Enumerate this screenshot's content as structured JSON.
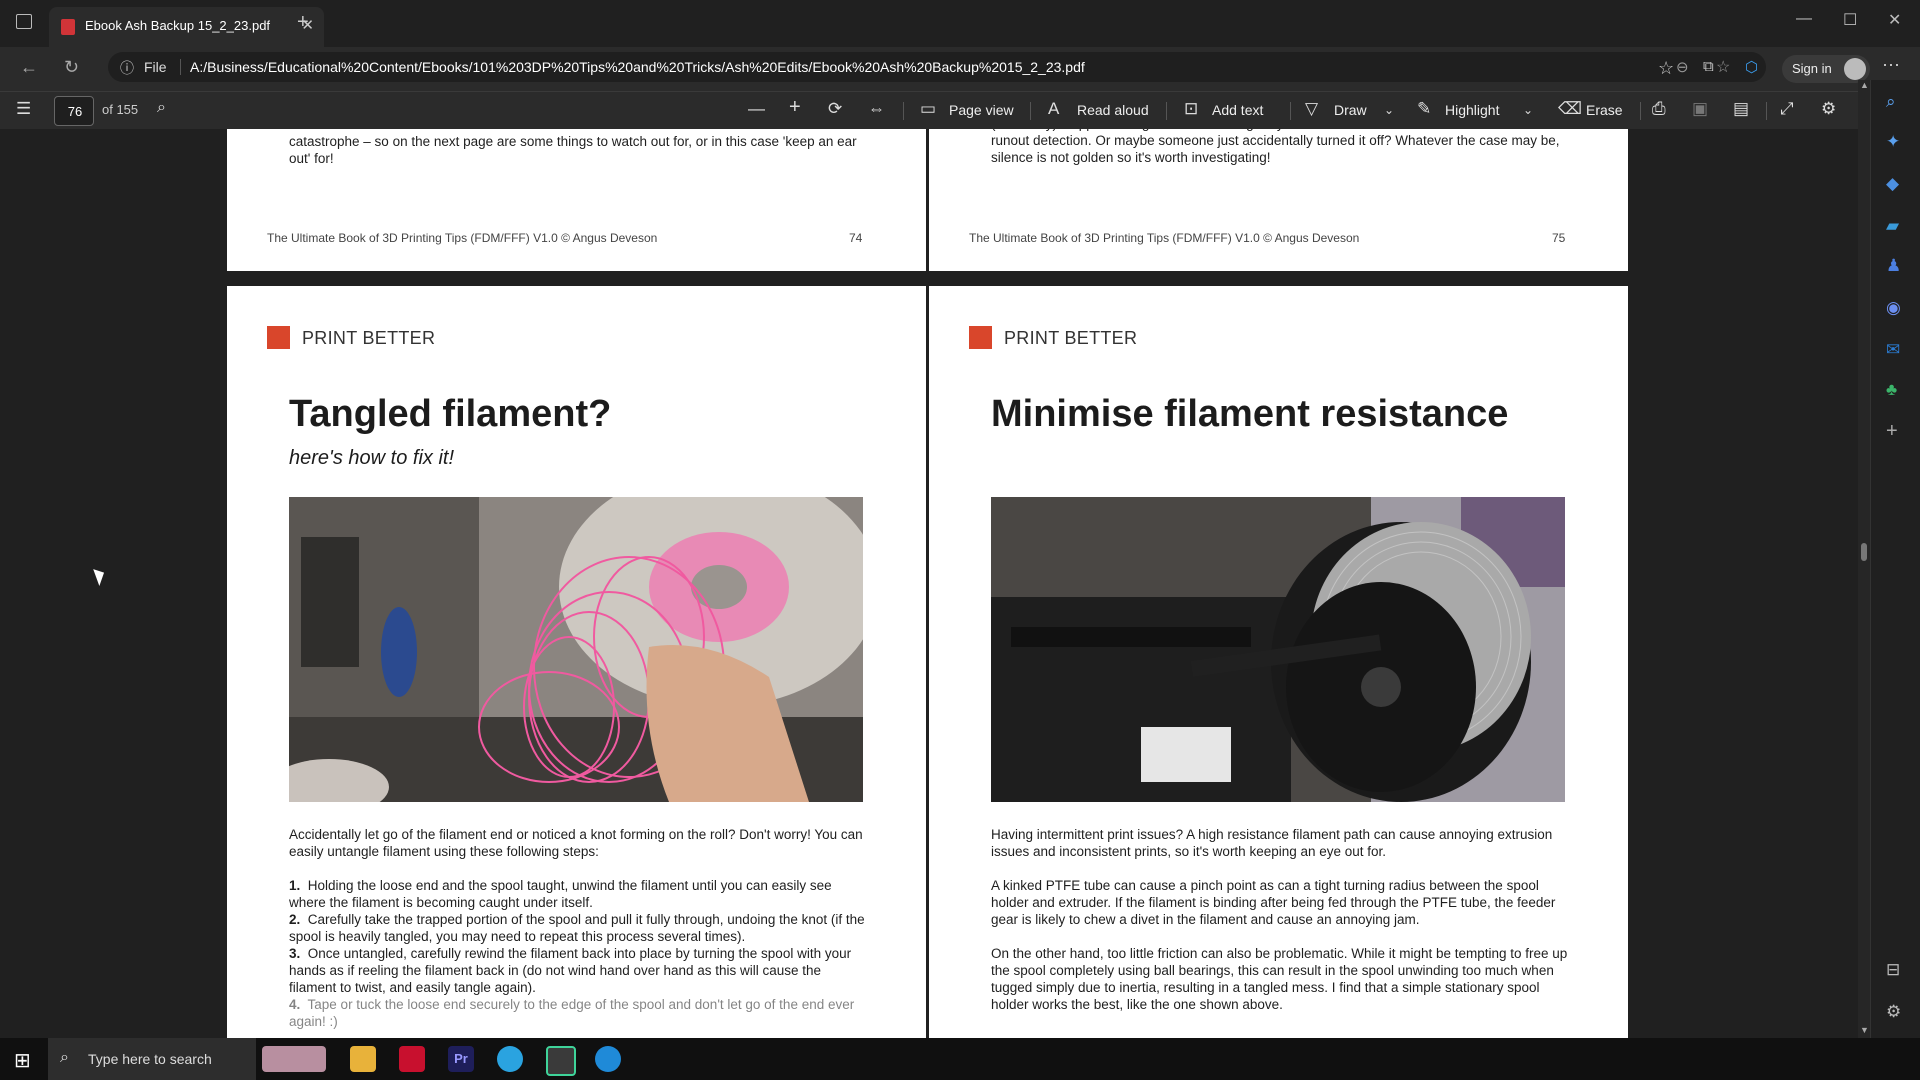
{
  "browser": {
    "tab_title": "Ebook Ash Backup 15_2_23.pdf",
    "address_label": "File",
    "url": "A:/Business/Educational%20Content/Ebooks/101%203DP%20Tips%20and%20Tricks/Ash%20Edits/Ebook%20Ash%20Backup%2015_2_23.pdf",
    "sign_in": "Sign in"
  },
  "pdf_toolbar": {
    "page_current": "76",
    "page_total": "of 155",
    "page_view": "Page view",
    "read_aloud": "Read aloud",
    "add_text": "Add text",
    "draw": "Draw",
    "highlight": "Highlight",
    "erase": "Erase"
  },
  "pages": {
    "p74": {
      "tail_text": "catastrophe – so on the next page are some things to watch out for, or in this case 'keep an ear out' for!",
      "footer": "The Ultimate Book of 3D Printing Tips (FDM/FFF) V1.0 © Angus Deveson",
      "number": "74"
    },
    "p75": {
      "tail_text": "(thankfully) stopped. It might also be waiting for you to load in more filament if it has filament runout detection. Or maybe someone just accidentally turned it off? Whatever the case may be, silence is not golden so it's worth investigating!",
      "footer": "The Ultimate Book of 3D Printing Tips (FDM/FFF) V1.0 © Angus Deveson",
      "number": "75"
    },
    "p76": {
      "section": "PRINT BETTER",
      "title": "Tangled filament?",
      "subtitle": "here's how to fix it!",
      "intro": "Accidentally let go of the filament end or noticed a knot forming on the roll? Don't worry! You can easily untangle filament using these following steps:",
      "steps": [
        {
          "n": "1.",
          "text": "Holding the loose end and the spool taught, unwind the filament until you can easily see where the filament is becoming caught under itself."
        },
        {
          "n": "2.",
          "text": "Carefully take the trapped portion of the spool and pull it fully through, undoing the knot (if the spool is heavily tangled, you may need to repeat this process several times)."
        },
        {
          "n": "3.",
          "text": "Once untangled, carefully rewind the filament back into place by turning the spool with your hands as if reeling the filament back in (do not wind hand over hand as this will cause the filament to twist, and easily tangle again)."
        },
        {
          "n": "4.",
          "text": "Tape or tuck the loose end securely to the edge of the spool and don't let go of the end ever again! :)"
        }
      ]
    },
    "p77": {
      "section": "PRINT BETTER",
      "title": "Minimise filament resistance",
      "paragraphs": [
        "Having intermittent print issues? A high resistance filament path can cause annoying extrusion issues and inconsistent prints, so it's worth keeping an eye out for.",
        "A kinked PTFE tube can cause a pinch point as can a tight turning radius between the spool holder and extruder. If the filament is binding after being fed through the PTFE tube, the feeder gear is likely to chew a divet in the filament and cause an annoying jam.",
        "On the other hand, too little friction can also be problematic. While it might be tempting to free up the spool completely using ball bearings, this can result in the spool unwinding too much when tugged simply due to inertia, resulting in a tangled mess. I find that a simple stationary spool holder works the best, like the one shown above."
      ]
    }
  },
  "taskbar": {
    "search_placeholder": "Type here to search"
  },
  "icons": {
    "accent": "#d9462b"
  }
}
